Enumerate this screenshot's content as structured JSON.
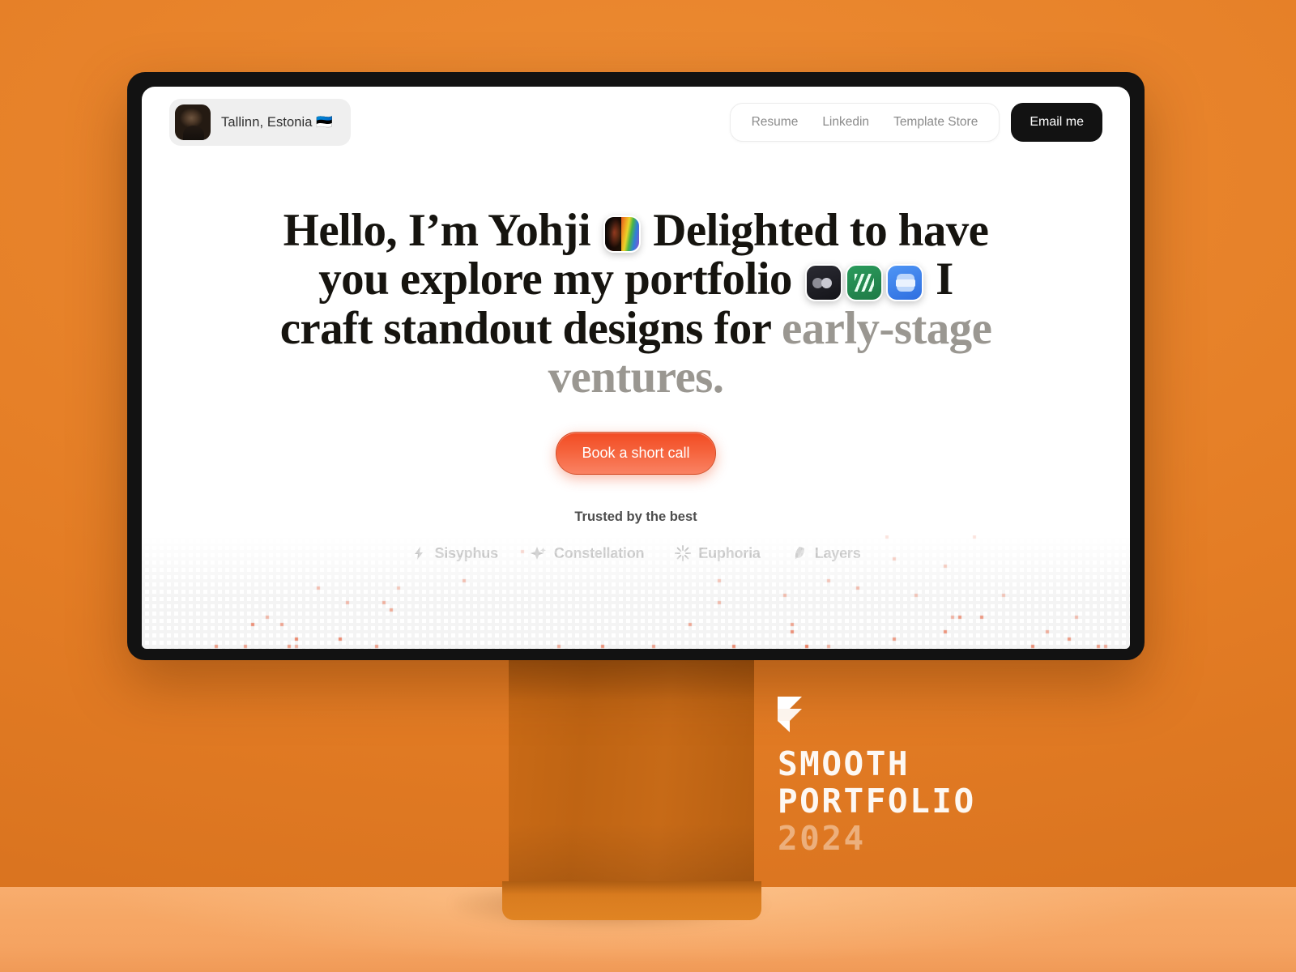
{
  "scene": {
    "background_color": "#e8822a",
    "floor_color": "#f6a765",
    "stand_color": "#c96a16"
  },
  "caption": {
    "logo": "framer-logo",
    "line1": "SMOOTH",
    "line2": "PORTFOLIO",
    "year": "2024"
  },
  "site": {
    "header": {
      "location_badge": {
        "avatar": "profile-avatar",
        "text": "Tallinn, Estonia 🇪🇪"
      },
      "nav_links": [
        {
          "label": "Resume"
        },
        {
          "label": "Linkedin"
        },
        {
          "label": "Template Store"
        }
      ],
      "cta_label": "Email me"
    },
    "hero": {
      "line1_a": "Hello, I’m Yohji",
      "line1_b": "Delighted to have you",
      "line2_a": "explore my portfolio",
      "line2_b": "I craft standout",
      "line3_a": "designs for ",
      "line3_muted": "early-stage ventures.",
      "icons": [
        {
          "name": "rainbow-portrait-icon"
        },
        {
          "name": "dark-rewind-icon"
        },
        {
          "name": "green-waves-icon"
        },
        {
          "name": "blue-mail-icon"
        }
      ],
      "cta_label": "Book a short call"
    },
    "trusted": {
      "label": "Trusted by the best",
      "logos": [
        {
          "name": "Sisyphus",
          "icon": "bolt-icon"
        },
        {
          "name": "Constellation",
          "icon": "star-icon"
        },
        {
          "name": "Euphoria",
          "icon": "burst-icon"
        },
        {
          "name": "Layers",
          "icon": "layers-icon"
        }
      ]
    },
    "accent_color": "#f4582c"
  }
}
